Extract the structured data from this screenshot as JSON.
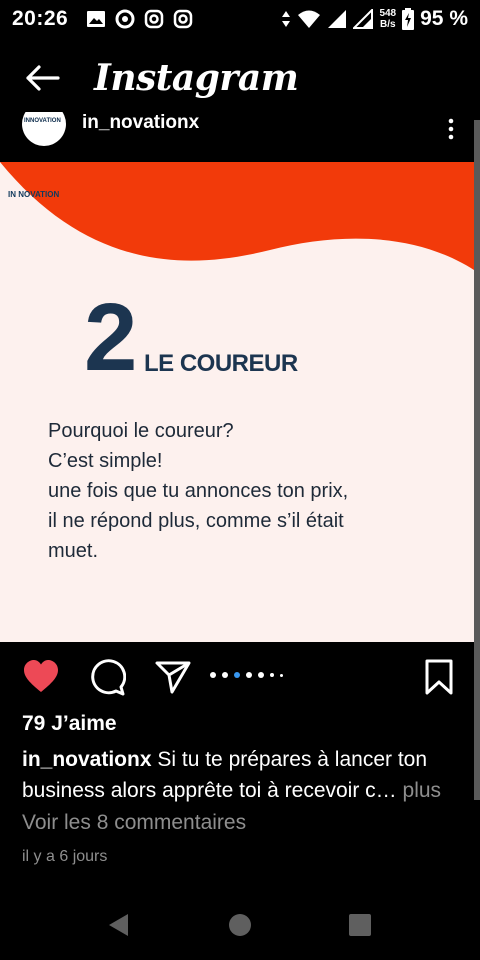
{
  "status_bar": {
    "time": "20:26",
    "net_speed_value": "548",
    "net_speed_unit": "B/s",
    "battery": "95 %",
    "icons": [
      "gallery-icon",
      "at-sign-icon",
      "instagram-icon",
      "instagram-icon",
      "data-arrows-icon",
      "wifi-icon",
      "signal-icon",
      "signal-icon",
      "battery-charging-icon"
    ]
  },
  "header": {
    "title": "Instagram",
    "back_icon": "arrow-left-icon"
  },
  "post": {
    "username": "in_novationx",
    "avatar_text": "INNOVATION",
    "image": {
      "logo_text": "IN NOVATION",
      "number": "2",
      "heading": "LE COUREUR",
      "lines": [
        "Pourquoi le coureur?",
        "C’est simple!",
        "une fois que tu annonces ton prix,",
        "il ne répond plus, comme s’il était",
        "muet."
      ],
      "colors": {
        "accent": "#f23a0a",
        "background": "#fdf1ee",
        "text": "#1c3550"
      }
    },
    "likes": "79 J’aime",
    "caption": {
      "user": "in_novationx",
      "text": " Si tu te prépares à lancer ton business alors apprête toi à recevoir c…",
      "more": " plus"
    },
    "comments_link": "Voir les 8 commentaires",
    "time_ago": "il y a 6 jours",
    "carousel": {
      "count": 7,
      "active_index": 2
    }
  },
  "nav": {
    "back": "triangle-back-icon",
    "home": "circle-home-icon",
    "recents": "square-recents-icon"
  },
  "colors": {
    "like": "#ed4956",
    "carousel_active": "#3897f0"
  }
}
